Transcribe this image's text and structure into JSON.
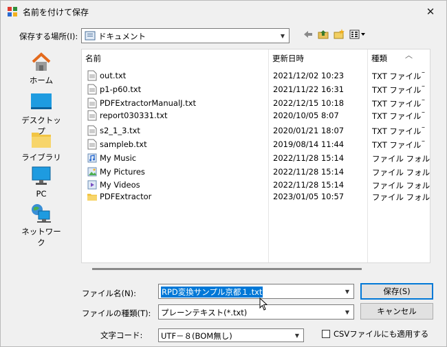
{
  "window": {
    "title": "名前を付けて保存",
    "close_glyph": "✕"
  },
  "location": {
    "label": "保存する場所(I):",
    "value": "ドキュメント"
  },
  "places": [
    {
      "label": "ホーム",
      "icon": "home-icon"
    },
    {
      "label": "デスクトップ",
      "icon": "desktop-icon"
    },
    {
      "label": "ライブラリ",
      "icon": "library-icon"
    },
    {
      "label": "PC",
      "icon": "pc-icon"
    },
    {
      "label": "ネットワーク",
      "icon": "network-icon"
    }
  ],
  "columns": {
    "name": "名前",
    "date": "更新日時",
    "type": "種類"
  },
  "files": [
    {
      "name": "out.txt",
      "date": "2021/12/02 10:23",
      "type": "TXT ファイル",
      "icon": "text-file-icon"
    },
    {
      "name": "p1-p60.txt",
      "date": "2021/11/22 16:31",
      "type": "TXT ファイル",
      "icon": "text-file-icon"
    },
    {
      "name": "PDFExtractorManualJ.txt",
      "date": "2022/12/15 10:18",
      "type": "TXT ファイル",
      "icon": "text-file-icon"
    },
    {
      "name": "report030331.txt",
      "date": "2020/10/05 8:07",
      "type": "TXT ファイル",
      "icon": "text-file-icon"
    },
    {
      "name": "s2_1_3.txt",
      "date": "2020/01/21 18:07",
      "type": "TXT ファイル",
      "icon": "text-file-icon"
    },
    {
      "name": "sampleb.txt",
      "date": "2019/08/14 11:44",
      "type": "TXT ファイル",
      "icon": "text-file-icon"
    },
    {
      "name": "My Music",
      "date": "2022/11/28 15:14",
      "type": "ファイル フォルダー",
      "icon": "music-folder-icon"
    },
    {
      "name": "My Pictures",
      "date": "2022/11/28 15:14",
      "type": "ファイル フォルダー",
      "icon": "pictures-folder-icon"
    },
    {
      "name": "My Videos",
      "date": "2022/11/28 15:14",
      "type": "ファイル フォルダー",
      "icon": "videos-folder-icon"
    },
    {
      "name": "PDFExtractor",
      "date": "2023/01/05 10:57",
      "type": "ファイル フォルダー",
      "icon": "folder-icon"
    }
  ],
  "form": {
    "filename_label": "ファイル名(N):",
    "filename_value": "RPD変換サンプル京都１.txt",
    "filetype_label": "ファイルの種類(T):",
    "filetype_value": "プレーンテキスト(*.txt)",
    "encoding_label": "文字コード:",
    "encoding_value": "UTF－８(BOM無し)",
    "save_button": "保存(S)",
    "cancel_button": "キャンセル",
    "csv_checkbox_label": "CSVファイルにも適用する",
    "csv_checked": false
  }
}
